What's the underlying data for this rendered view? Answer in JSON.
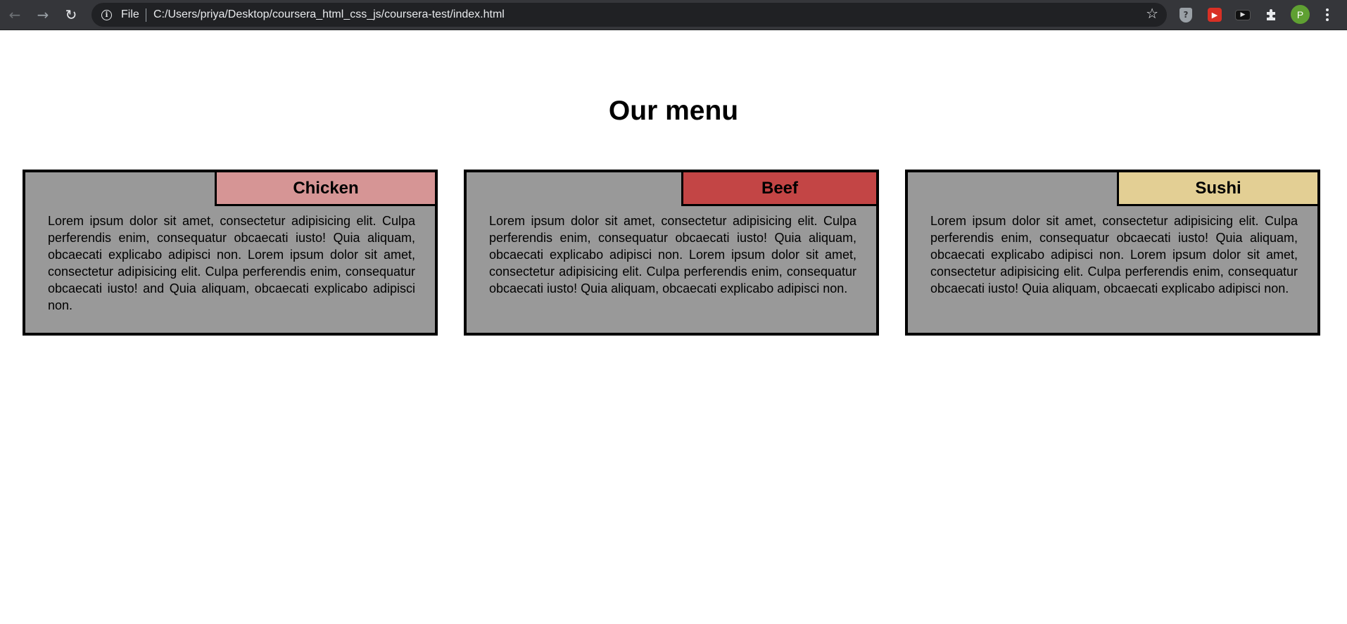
{
  "browser": {
    "scheme_label": "File",
    "url": "C:/Users/priya/Desktop/coursera_html_css_js/coursera-test/index.html",
    "avatar_letter": "P",
    "icons": [
      "back-arrow-icon",
      "forward-arrow-icon",
      "reload-icon",
      "info-icon",
      "star-icon",
      "shield-extension-icon",
      "red-extension-icon",
      "video-extension-icon",
      "puzzle-extensions-icon",
      "kebab-menu-icon"
    ]
  },
  "page": {
    "title": "Our menu",
    "sections": [
      {
        "title": "Chicken",
        "title_bg": "#d69595",
        "text": "Lorem ipsum dolor sit amet, consectetur adipisicing elit. Culpa perferendis enim, consequatur obcaecati iusto! Quia aliquam, obcaecati explicabo adipisci non. Lorem ipsum dolor sit amet, consectetur adipisicing elit. Culpa perferendis enim, consequatur obcaecati iusto! and Quia aliquam, obcaecati explicabo adipisci non."
      },
      {
        "title": "Beef",
        "title_bg": "#c34545",
        "text": "Lorem ipsum dolor sit amet, consectetur adipisicing elit. Culpa perferendis enim, consequatur obcaecati iusto! Quia aliquam, obcaecati explicabo adipisci non. Lorem ipsum dolor sit amet, consectetur adipisicing elit. Culpa perferendis enim, consequatur obcaecati iusto! Quia aliquam, obcaecati explicabo adipisci non."
      },
      {
        "title": "Sushi",
        "title_bg": "#e3cf94",
        "text": "Lorem ipsum dolor sit amet, consectetur adipisicing elit. Culpa perferendis enim, consequatur obcaecati iusto! Quia aliquam, obcaecati explicabo adipisci non. Lorem ipsum dolor sit amet, consectetur adipisicing elit. Culpa perferendis enim, consequatur obcaecati iusto! Quia aliquam, obcaecati explicabo adipisci non."
      }
    ],
    "section_bg": "#999999",
    "border_color": "#000000"
  }
}
